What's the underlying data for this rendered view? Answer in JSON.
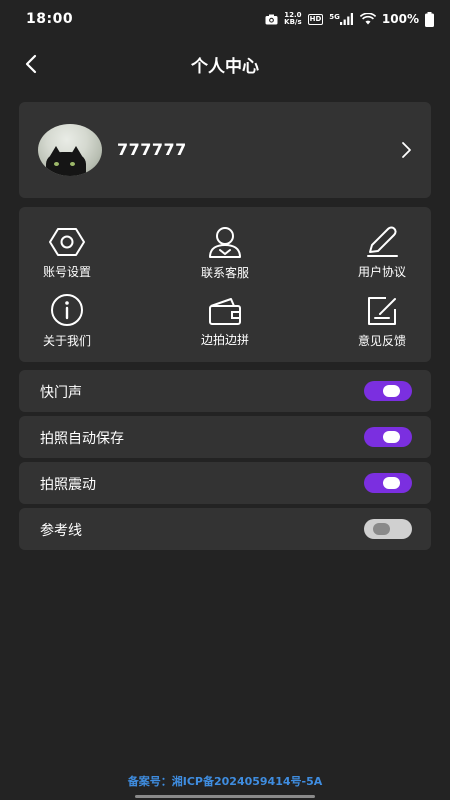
{
  "status_bar": {
    "time": "18:00",
    "net_speed_value": "12.0",
    "net_speed_unit": "KB/s",
    "hd": "HD",
    "network": "5G",
    "battery": "100%"
  },
  "header": {
    "title": "个人中心"
  },
  "profile": {
    "username": "777777"
  },
  "menu": {
    "items": [
      {
        "label": "账号设置",
        "icon": "hexagon-settings-icon"
      },
      {
        "label": "联系客服",
        "icon": "customer-service-icon"
      },
      {
        "label": "用户协议",
        "icon": "pen-icon"
      },
      {
        "label": "关于我们",
        "icon": "info-icon"
      },
      {
        "label": "边拍边拼",
        "icon": "wallet-icon"
      },
      {
        "label": "意见反馈",
        "icon": "feedback-edit-icon"
      }
    ]
  },
  "settings": {
    "toggles": [
      {
        "label": "快门声",
        "on": true
      },
      {
        "label": "拍照自动保存",
        "on": true
      },
      {
        "label": "拍照震动",
        "on": true
      },
      {
        "label": "参考线",
        "on": false
      }
    ]
  },
  "footer": {
    "record": "备案号：湘ICP备2024059414号-5A"
  },
  "colors": {
    "accent": "#7b2fe0",
    "background": "#232323",
    "card": "#333333",
    "link": "#3f8de0"
  }
}
